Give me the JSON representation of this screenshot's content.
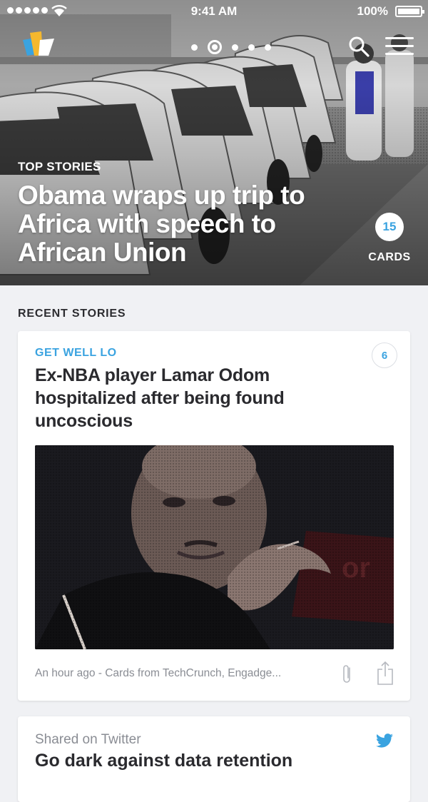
{
  "status_bar": {
    "time": "9:41 AM",
    "battery": "100%"
  },
  "hero": {
    "section_label": "TOP STORIES",
    "headline": "Obama wraps up trip to Africa with speech to African Union",
    "card_count": "15",
    "card_count_label": "CARDS",
    "pager": {
      "total": 5,
      "active_index": 1
    }
  },
  "icons": {
    "logo": "app-logo-icon",
    "search": "search-icon",
    "menu": "menu-icon",
    "clip": "paperclip-icon",
    "share": "share-icon",
    "twitter": "twitter-icon"
  },
  "colors": {
    "accent": "#3aa3e0",
    "background": "#f0f1f4",
    "text_dark": "#2a2a2e",
    "text_meta": "#8a8d94"
  },
  "recent": {
    "heading": "RECENT STORIES",
    "cards": [
      {
        "tag": "GET WELL LO",
        "count": "6",
        "title": "Ex-NBA player Lamar Odom hospitalized after being found uncoscious",
        "meta": "An hour ago - Cards from TechCrunch, Engadge..."
      },
      {
        "source": "Shared on Twitter",
        "title": "Go dark against data retention"
      }
    ]
  }
}
